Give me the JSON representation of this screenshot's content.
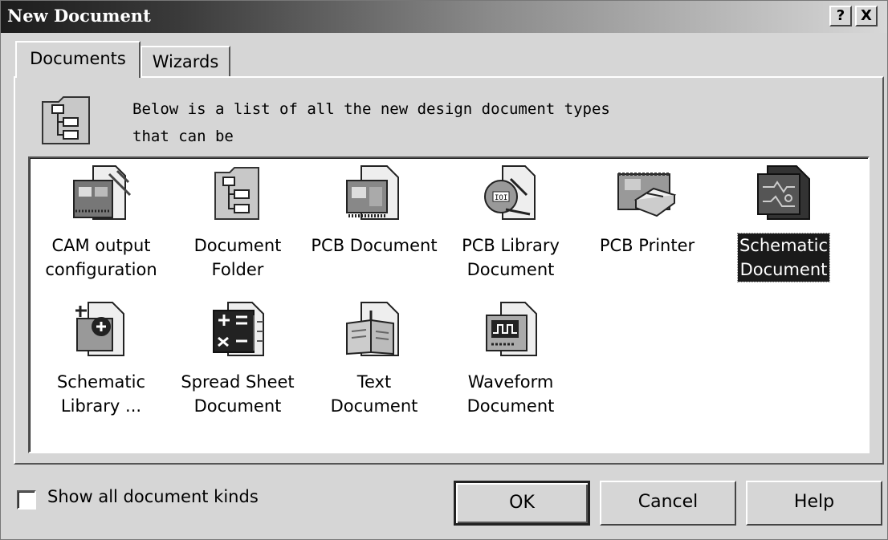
{
  "window": {
    "title": "New Document",
    "help_button": "?",
    "close_button": "X"
  },
  "tabs": [
    {
      "label": "Documents",
      "active": true
    },
    {
      "label": "Wizards",
      "active": false
    }
  ],
  "description": {
    "line1": "Below is a list of all the new design document types",
    "line2": "that can be"
  },
  "items": [
    {
      "label": "CAM output\nconfiguration",
      "icon": "cam-output-icon"
    },
    {
      "label": "Document\nFolder",
      "icon": "document-folder-icon"
    },
    {
      "label": "PCB Document",
      "icon": "pcb-document-icon"
    },
    {
      "label": "PCB Library\nDocument",
      "icon": "pcb-library-icon"
    },
    {
      "label": "PCB Printer",
      "icon": "pcb-printer-icon"
    },
    {
      "label": "Schematic\nDocument",
      "icon": "schematic-document-icon",
      "selected": true
    },
    {
      "label": "Schematic\nLibrary ...",
      "icon": "schematic-library-icon"
    },
    {
      "label": "Spread Sheet\nDocument",
      "icon": "spreadsheet-icon"
    },
    {
      "label": "Text\nDocument",
      "icon": "text-document-icon"
    },
    {
      "label": "Waveform\nDocument",
      "icon": "waveform-document-icon"
    }
  ],
  "footer": {
    "show_all_label": "Show all document kinds",
    "show_all_checked": false,
    "ok_label": "OK",
    "cancel_label": "Cancel",
    "help_label": "Help"
  }
}
